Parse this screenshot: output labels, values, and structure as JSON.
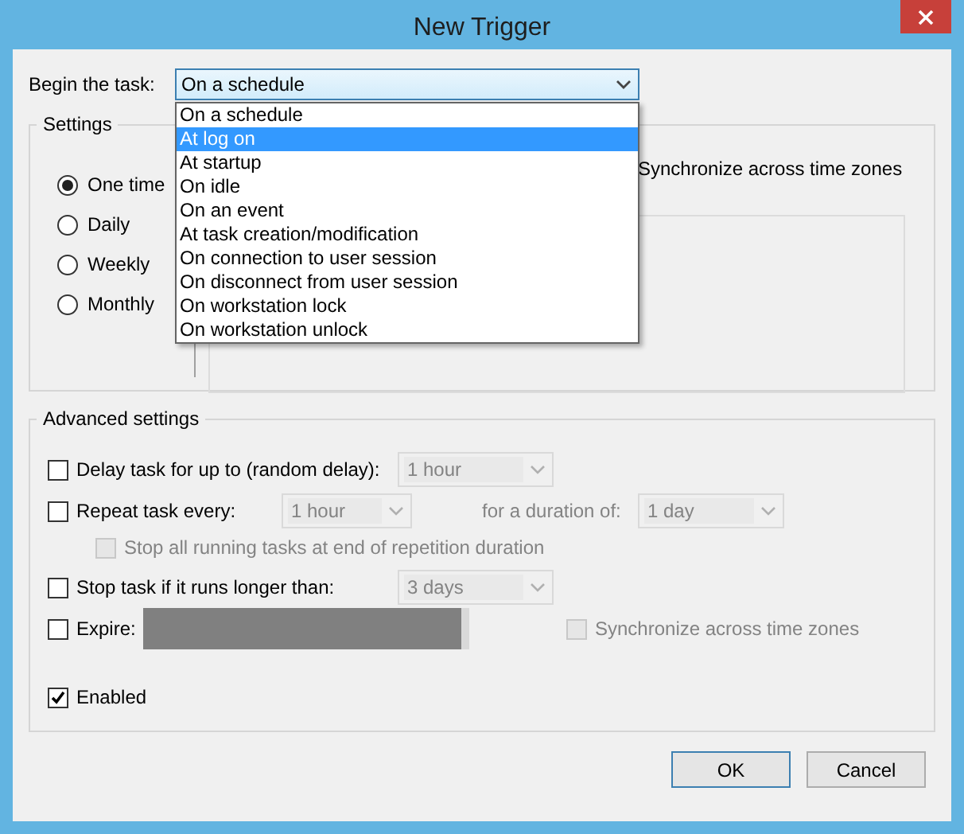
{
  "window": {
    "title": "New Trigger"
  },
  "begin_task": {
    "label": "Begin the task:",
    "value": "On a schedule",
    "expanded": true,
    "options": [
      {
        "label": "On a schedule",
        "highlighted": false
      },
      {
        "label": "At log on",
        "highlighted": true
      },
      {
        "label": "At startup",
        "highlighted": false
      },
      {
        "label": "On idle",
        "highlighted": false
      },
      {
        "label": "On an event",
        "highlighted": false
      },
      {
        "label": "At task creation/modification",
        "highlighted": false
      },
      {
        "label": "On connection to user session",
        "highlighted": false
      },
      {
        "label": "On disconnect from user session",
        "highlighted": false
      },
      {
        "label": "On workstation lock",
        "highlighted": false
      },
      {
        "label": "On workstation unlock",
        "highlighted": false
      }
    ]
  },
  "settings": {
    "title": "Settings",
    "schedules": [
      {
        "label": "One time",
        "selected": true
      },
      {
        "label": "Daily",
        "selected": false
      },
      {
        "label": "Weekly",
        "selected": false
      },
      {
        "label": "Monthly",
        "selected": false
      }
    ],
    "sync_label": "Synchronize across time zones"
  },
  "advanced": {
    "title": "Advanced settings",
    "delay": {
      "label": "Delay task for up to (random delay):",
      "checked": false,
      "value": "1 hour"
    },
    "repeat": {
      "label": "Repeat task every:",
      "checked": false,
      "value": "1 hour",
      "duration_label": "for a duration of:",
      "duration_value": "1 day"
    },
    "stop_all": {
      "label": "Stop all running tasks at end of repetition duration",
      "checked": false,
      "disabled": true
    },
    "stop_long": {
      "label": "Stop task if it runs longer than:",
      "checked": false,
      "value": "3 days"
    },
    "expire": {
      "label": "Expire:",
      "checked": false
    },
    "sync": {
      "label": "Synchronize across time zones",
      "checked": false,
      "disabled": true
    },
    "enabled": {
      "label": "Enabled",
      "checked": true
    }
  },
  "buttons": [
    {
      "label": "OK",
      "default": true
    },
    {
      "label": "Cancel",
      "default": false
    }
  ]
}
